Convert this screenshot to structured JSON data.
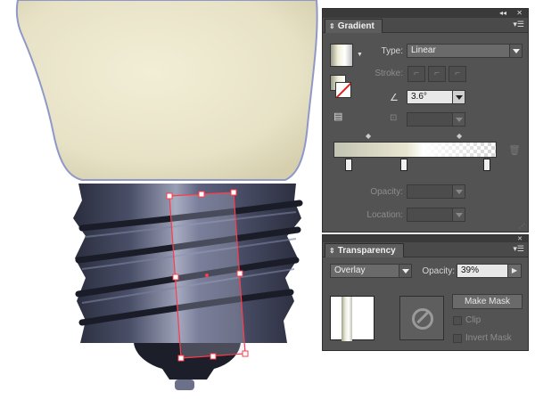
{
  "gradient_panel": {
    "title": "Gradient",
    "type_label": "Type:",
    "type_value": "Linear",
    "stroke_label": "Stroke:",
    "angle_value": "3.6°",
    "opacity_label": "Opacity:",
    "location_label": "Location:"
  },
  "transparency_panel": {
    "title": "Transparency",
    "blend_mode": "Overlay",
    "opacity_label": "Opacity:",
    "opacity_value": "39%",
    "make_mask_label": "Make Mask",
    "clip_label": "Clip",
    "invert_mask_label": "Invert Mask"
  },
  "colors": {
    "bulb_glass": "#e6e1c5",
    "bulb_base": "#3b3f56",
    "panel_bg": "#535353",
    "selection": "#ff3b4a"
  }
}
